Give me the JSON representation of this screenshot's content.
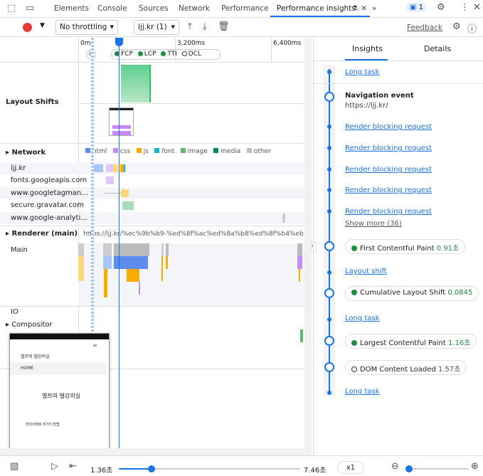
{
  "tabs": {
    "items": [
      "Elements",
      "Console",
      "Sources",
      "Network",
      "Performance",
      "Performance insights"
    ],
    "active": "Performance insights",
    "more": "»",
    "issues_count": "1"
  },
  "toolbar": {
    "throttling": "No throttling",
    "recording": "ljj.kr (1)",
    "feedback": "Feedback",
    "record_color": "#e53935"
  },
  "timeline": {
    "ticks": [
      "0ms",
      "3,200ms",
      "6,400ms"
    ],
    "markers": [
      "FCP",
      "LCP",
      "TTI",
      "DCL"
    ]
  },
  "tracks": {
    "layout_shifts": "Layout Shifts",
    "network": "Network",
    "renderer": "Renderer (main)",
    "renderer_url": "https://ljj.kr/%ec%9b%b9-%ed%8f%ac%ed%8a%b8%ed%8f%b4%eb%a6%ac%",
    "main": "Main",
    "io": "IO",
    "compositor": "Compositor"
  },
  "legend": [
    {
      "label": "html",
      "color": "#5b8def"
    },
    {
      "label": "css",
      "color": "#c58af9"
    },
    {
      "label": "js",
      "color": "#f9ab00"
    },
    {
      "label": "font",
      "color": "#12b5cb"
    },
    {
      "label": "image",
      "color": "#5bb974"
    },
    {
      "label": "media",
      "color": "#00875a"
    },
    {
      "label": "other",
      "color": "#bdc1c6"
    }
  ],
  "network_rows": [
    "ljj.kr",
    "fonts.googleapis.com",
    "www.googletagman...",
    "secure.gravatar.com",
    "www.google-analyti..."
  ],
  "screenshot": {
    "site_title": "엘쯔의 텔강의실",
    "nav": "HOME",
    "heading": "엘쯔의 텔강의실",
    "post": "리다이렉트 5가지 방법"
  },
  "insights": {
    "tabs": [
      "Insights",
      "Details"
    ],
    "active": "Insights",
    "long_task": "Long task",
    "nav_title": "Navigation event",
    "nav_url": "https://ljj.kr/",
    "render_blocking": [
      "Render blocking request",
      "Render blocking request",
      "Render blocking request",
      "Render blocking request",
      "Render blocking request"
    ],
    "show_more": "Show more (36)",
    "fcp": {
      "label": "First Contentful Paint",
      "value": "0.91초"
    },
    "layout_shift": "Layout shift",
    "cls": {
      "label": "Cumulative Layout Shift",
      "value": "0.0845"
    },
    "long_task2": "Long task",
    "lcp": {
      "label": "Largest Contentful Paint",
      "value": "1.16초"
    },
    "dcl": {
      "label": "DOM Content Loaded",
      "value": "1.57초"
    },
    "long_task3": "Long task"
  },
  "playback": {
    "current": "1.36초",
    "total": "7.46초",
    "speed": "x1",
    "progress": 0.18,
    "zoom": 0.05
  }
}
